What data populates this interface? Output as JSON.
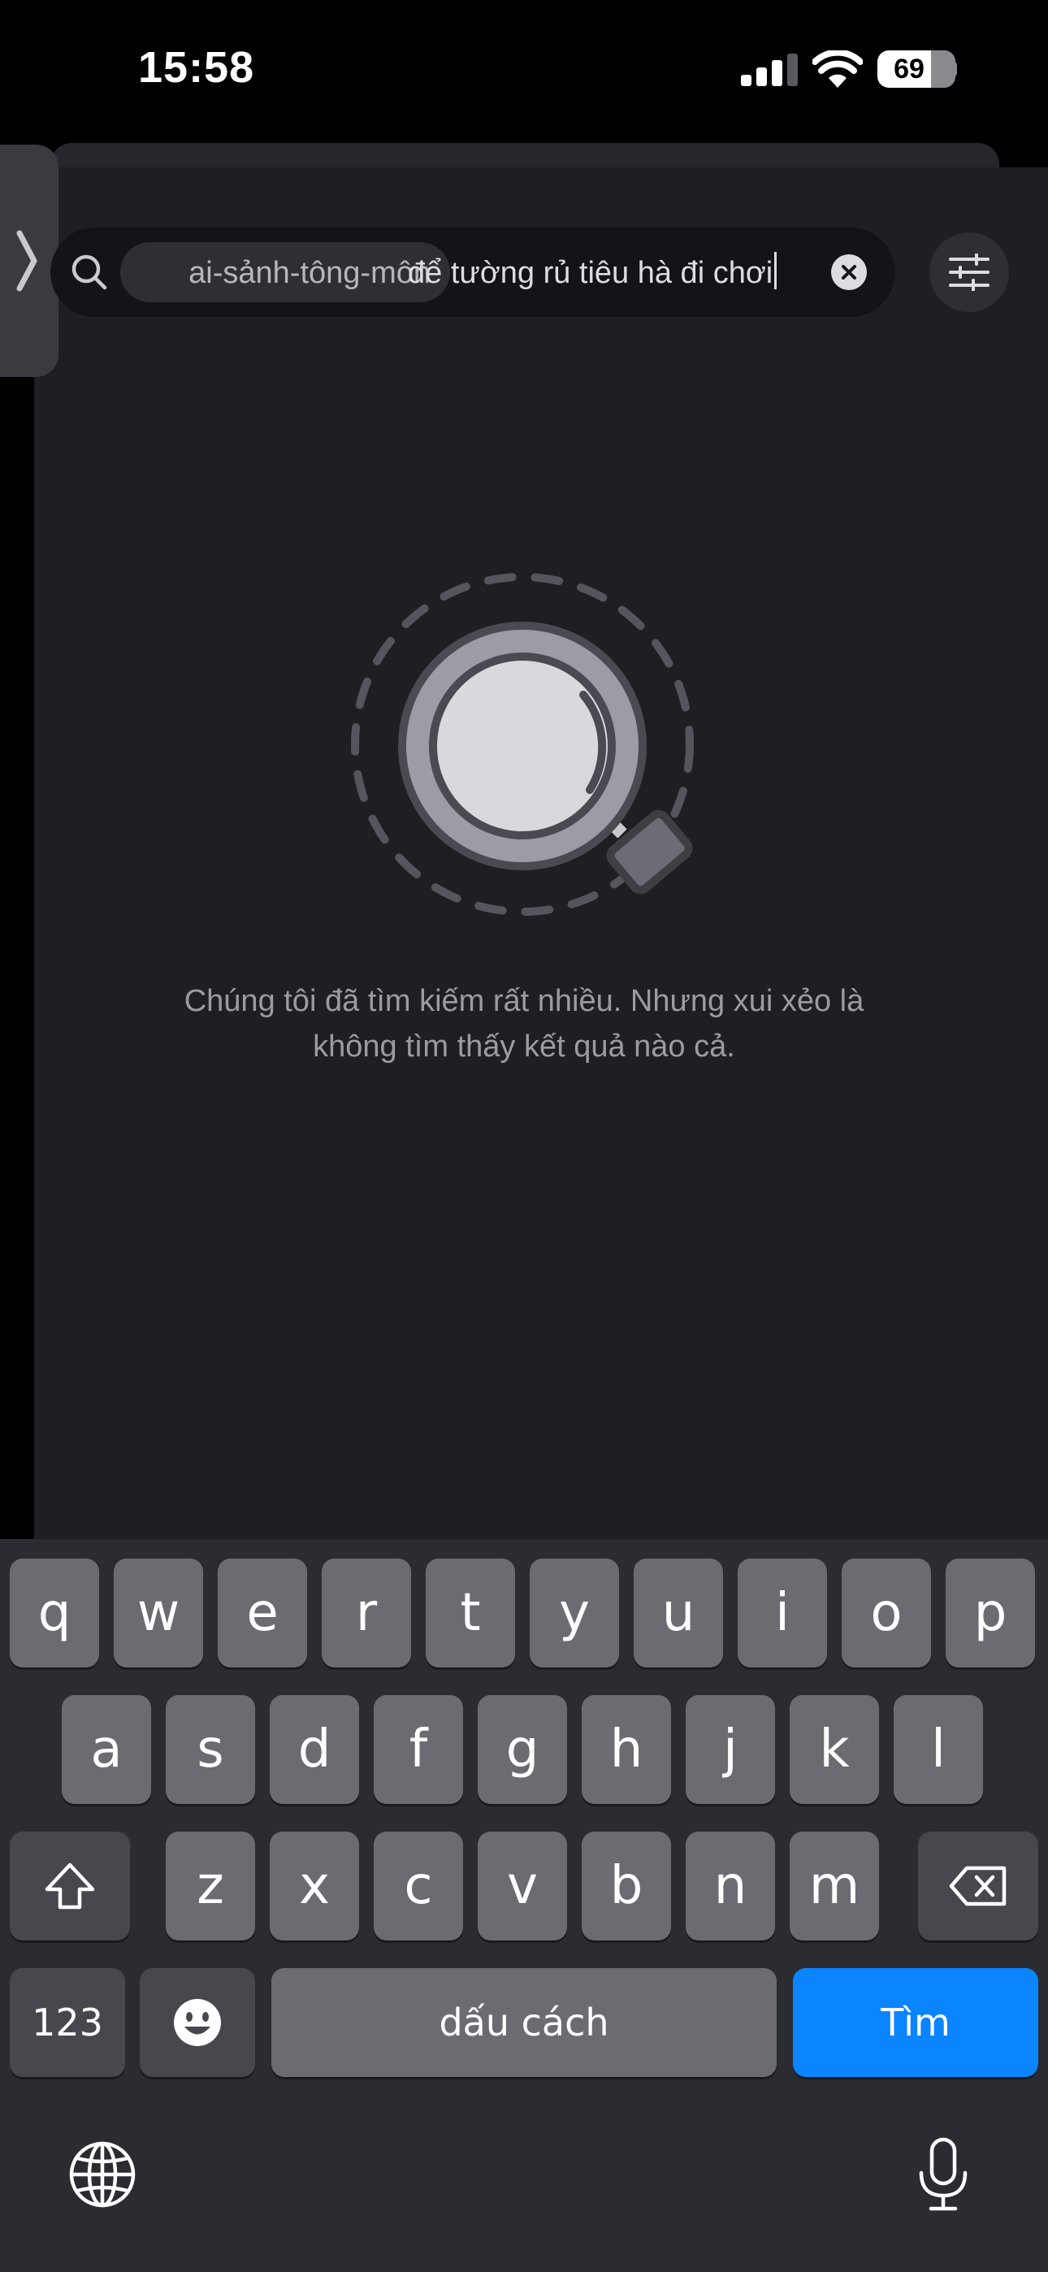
{
  "status_bar": {
    "time": "15:58",
    "battery_percent": "69",
    "battery_level": 0.69,
    "signal_bars": 3
  },
  "search": {
    "channel_chip": "ai-sảnh-tông-môn",
    "query": "để tường rủ tiêu hà đi chơi"
  },
  "empty_state": {
    "message_line1": "Chúng tôi đã tìm kiếm rất nhiều. Nhưng xui xẻo là",
    "message_line2": "không tìm thấy kết quả nào cả."
  },
  "keyboard": {
    "row1": [
      "q",
      "w",
      "e",
      "r",
      "t",
      "y",
      "u",
      "i",
      "o",
      "p"
    ],
    "row2": [
      "a",
      "s",
      "d",
      "f",
      "g",
      "h",
      "j",
      "k",
      "l"
    ],
    "row3": [
      "z",
      "x",
      "c",
      "v",
      "b",
      "n",
      "m"
    ],
    "numbers_key": "123",
    "space_key": "dấu cách",
    "return_key": "Tìm"
  },
  "colors": {
    "background": "#1e1f23",
    "accent": "#0a84ff",
    "text_muted": "#9a9ca3"
  },
  "icons": [
    "search-icon",
    "clear-icon",
    "filter-icon",
    "chevron-right-icon",
    "shift-icon",
    "backspace-icon",
    "emoji-icon",
    "globe-icon",
    "microphone-icon",
    "wifi-icon",
    "signal-icon",
    "battery-icon"
  ]
}
